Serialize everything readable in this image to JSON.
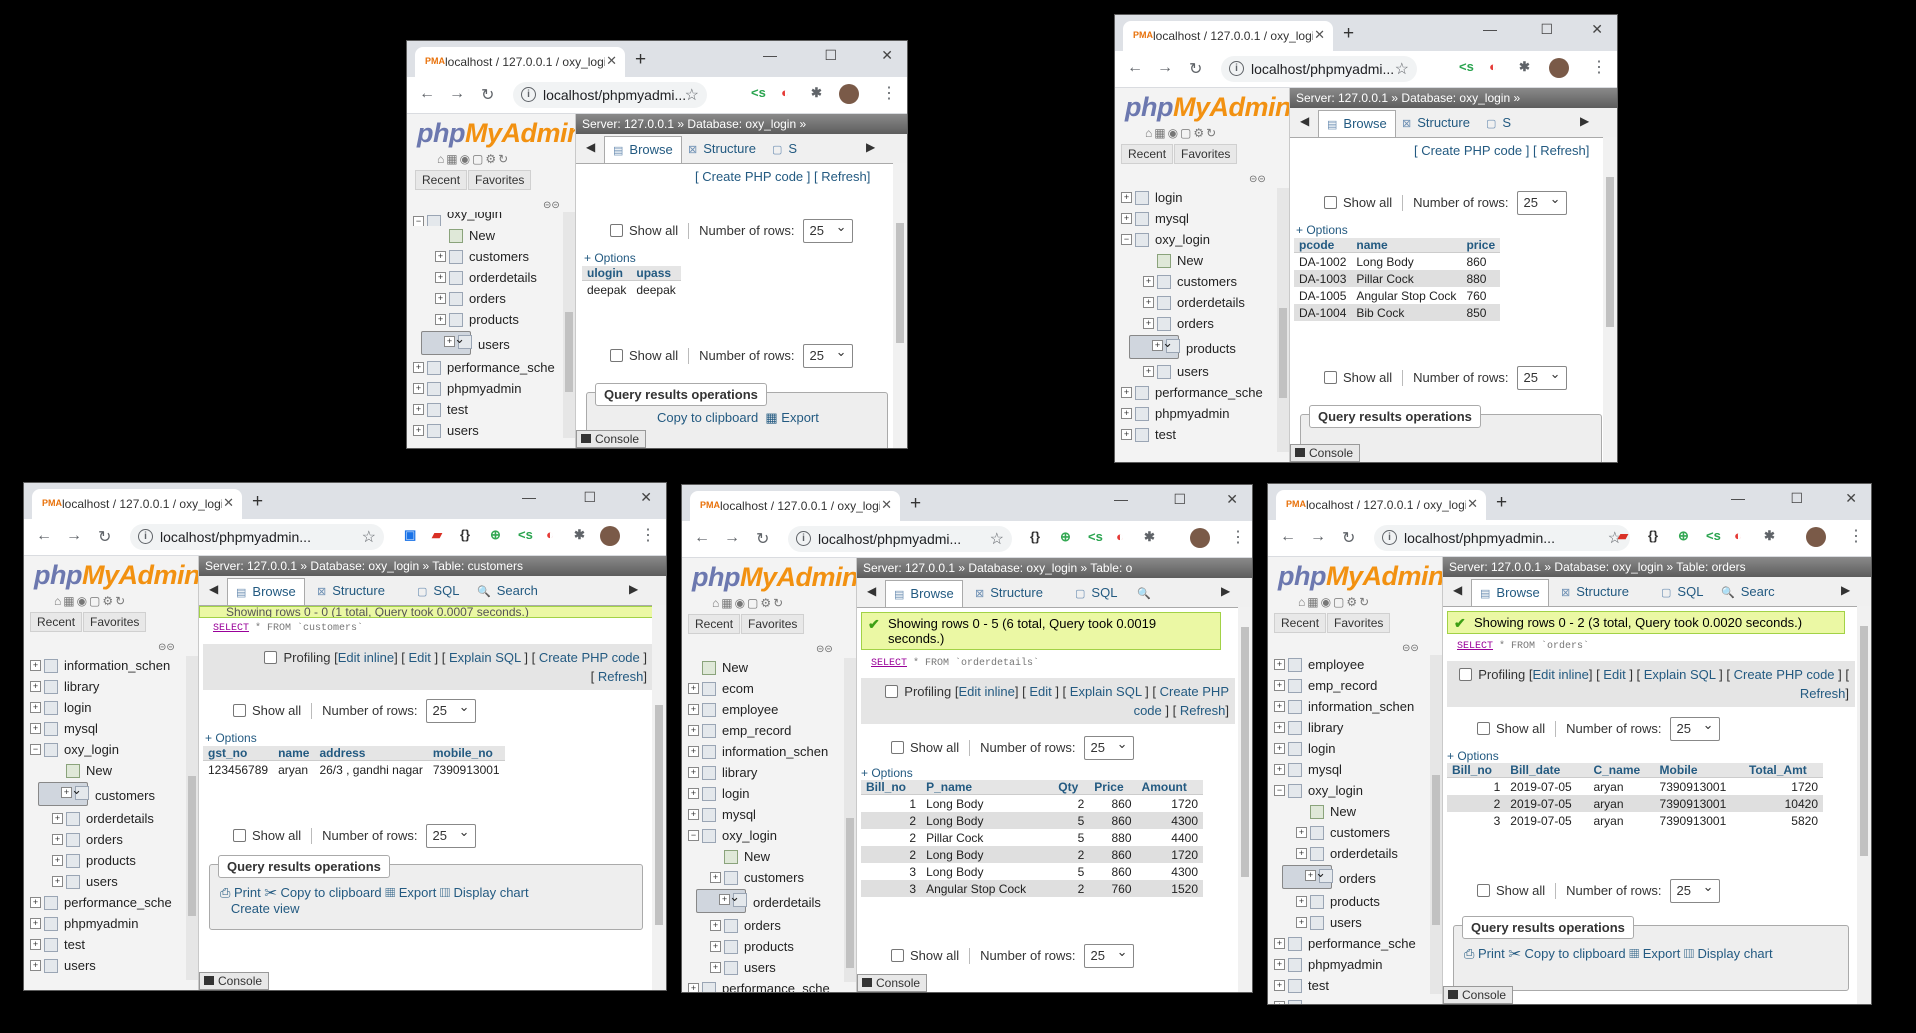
{
  "browser": {
    "tab_title": "localhost / 127.0.0.1 / oxy_login / ...",
    "new_tab": "+",
    "url": "localhost/phpmyadmi...",
    "url_long": "localhost/phpmyadmin...",
    "minimize": "—",
    "maximize": "☐",
    "close": "✕"
  },
  "pma": {
    "logo_php": "php",
    "logo_myadmin": "MyAdmin",
    "recent": "Recent",
    "favorites": "Favorites",
    "show_all": "Show all",
    "number_of_rows": "Number of rows:",
    "rows_value": "25",
    "options": "+ Options",
    "qro_title": "Query results operations",
    "console": "Console",
    "browse": "Browse",
    "structure": "Structure",
    "sql": "SQL",
    "search": "Search",
    "search_short": "Searc",
    "s_short": "S",
    "create_php_code": "Create PHP code",
    "refresh": "Refresh",
    "profiling": "Profiling",
    "edit_inline": "Edit inline",
    "edit": "Edit",
    "explain_sql": "Explain SQL",
    "print": "Print",
    "copy_to_clipboard": "Copy to clipboard",
    "export": "Export",
    "display_chart": "Display chart",
    "create_view": "Create view"
  },
  "w1": {
    "breadcrumb": "Server: 127.0.0.1 » Database: oxy_login »",
    "tree": [
      "oxy_login",
      "New",
      "customers",
      "orderdetails",
      "orders",
      "products",
      "users",
      "performance_sche",
      "phpmyadmin",
      "test",
      "users"
    ],
    "columns": [
      "ulogin",
      "upass"
    ],
    "rows": [
      [
        "deepak",
        "deepak"
      ]
    ]
  },
  "w2": {
    "breadcrumb": "Server: 127.0.0.1 » Database: oxy_login »",
    "tree": [
      "login",
      "mysql",
      "oxy_login",
      "New",
      "customers",
      "orderdetails",
      "orders",
      "products",
      "users",
      "performance_sche",
      "phpmyadmin",
      "test"
    ],
    "columns": [
      "pcode",
      "name",
      "price"
    ],
    "rows": [
      [
        "DA-1002",
        "Long Body",
        "860"
      ],
      [
        "DA-1003",
        "Pillar Cock",
        "880"
      ],
      [
        "DA-1005",
        "Angular Stop Cock",
        "760"
      ],
      [
        "DA-1004",
        "Bib Cock",
        "850"
      ]
    ]
  },
  "w3": {
    "breadcrumb": "Server: 127.0.0.1 » Database: oxy_login » Table: customers",
    "succ_partial": "Showing rows 0 - 0 (1 total, Query took 0.0007 seconds.)",
    "sql_select": "SELECT",
    "sql_rest": " * FROM `customers`",
    "tree": [
      "information_schen",
      "library",
      "login",
      "mysql",
      "oxy_login",
      "New",
      "customers",
      "orderdetails",
      "orders",
      "products",
      "users",
      "performance_sche",
      "phpmyadmin",
      "test",
      "users"
    ],
    "columns": [
      "gst_no",
      "name",
      "address",
      "mobile_no"
    ],
    "rows": [
      [
        "123456789",
        "aryan",
        "26/3 , gandhi nagar",
        "7390913001"
      ]
    ]
  },
  "w4": {
    "breadcrumb": "Server: 127.0.0.1 » Database: oxy_login » Table: o",
    "succ": "Showing rows 0 - 5 (6 total, Query took 0.0019 seconds.)",
    "sql_select": "SELECT",
    "sql_rest": " * FROM `orderdetails`",
    "tree": [
      "New",
      "ecom",
      "employee",
      "emp_record",
      "information_schen",
      "library",
      "login",
      "mysql",
      "oxy_login",
      "New",
      "customers",
      "orderdetails",
      "orders",
      "products",
      "users",
      "performance_sche"
    ],
    "columns": [
      "Bill_no",
      "P_name",
      "Qty",
      "Price",
      "Amount"
    ],
    "rows": [
      [
        "1",
        "Long Body",
        "2",
        "860",
        "1720"
      ],
      [
        "2",
        "Long Body",
        "5",
        "860",
        "4300"
      ],
      [
        "2",
        "Pillar Cock",
        "5",
        "880",
        "4400"
      ],
      [
        "2",
        "Long Body",
        "2",
        "860",
        "1720"
      ],
      [
        "3",
        "Long Body",
        "5",
        "860",
        "4300"
      ],
      [
        "3",
        "Angular Stop Cock",
        "2",
        "760",
        "1520"
      ]
    ]
  },
  "w5": {
    "breadcrumb": "Server: 127.0.0.1 » Database: oxy_login » Table: orders",
    "succ": "Showing rows 0 - 2 (3 total, Query took 0.0020 seconds.)",
    "sql_select": "SELECT",
    "sql_rest": " * FROM `orders`",
    "tree": [
      "employee",
      "emp_record",
      "information_schen",
      "library",
      "login",
      "mysql",
      "oxy_login",
      "New",
      "customers",
      "orderdetails",
      "orders",
      "products",
      "users",
      "performance_sche",
      "phpmyadmin",
      "test",
      "users"
    ],
    "columns": [
      "Bill_no",
      "Bill_date",
      "C_name",
      "Mobile",
      "Total_Amt"
    ],
    "rows": [
      [
        "1",
        "2019-07-05",
        "aryan",
        "7390913001",
        "1720"
      ],
      [
        "2",
        "2019-07-05",
        "aryan",
        "7390913001",
        "10420"
      ],
      [
        "3",
        "2019-07-05",
        "aryan",
        "7390913001",
        "5820"
      ]
    ]
  }
}
